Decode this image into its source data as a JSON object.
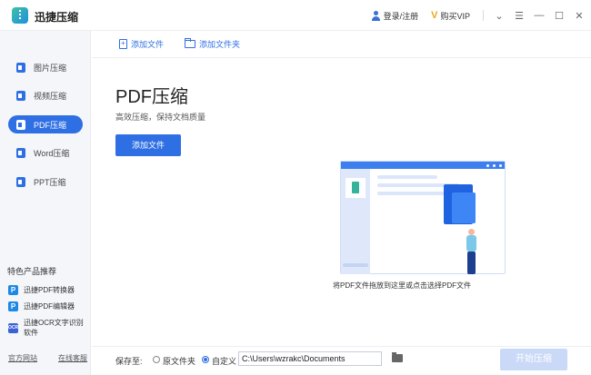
{
  "app": {
    "title": "迅捷压缩"
  },
  "titlebar": {
    "login": "登录/注册",
    "vip_badge": "V",
    "vip": "购买VIP",
    "controls": [
      "chevron-down-icon",
      "menu-icon",
      "minimize-icon",
      "maximize-icon",
      "close-icon"
    ]
  },
  "sidebar": {
    "items": [
      {
        "label": "图片压缩",
        "icon": "image-icon"
      },
      {
        "label": "视频压缩",
        "icon": "video-icon"
      },
      {
        "label": "PDF压缩",
        "icon": "pdf-icon",
        "active": true
      },
      {
        "label": "Word压缩",
        "icon": "word-icon"
      },
      {
        "label": "PPT压缩",
        "icon": "ppt-icon"
      }
    ],
    "featured_title": "特色产品推荐",
    "featured": [
      {
        "label": "迅捷PDF转换器",
        "badge": "P"
      },
      {
        "label": "迅捷PDF编辑器",
        "badge": "P"
      },
      {
        "label": "迅捷OCR文字识别软件",
        "badge": "OCR"
      }
    ],
    "footer": {
      "website": "官方网站",
      "support": "在线客服"
    }
  },
  "toolbar": {
    "add_file": "添加文件",
    "add_folder": "添加文件夹"
  },
  "main": {
    "title": "PDF压缩",
    "subtitle": "高效压缩，保持文档质量",
    "add_button": "添加文件",
    "drop_hint": "将PDF文件拖放到这里或点击选择PDF文件"
  },
  "bottom": {
    "save_to": "保存至:",
    "option_original": "原文件夹",
    "option_custom": "自定义",
    "selected_option": "自定义",
    "path": "C:\\Users\\wzrakc\\Documents",
    "start_button": "开始压缩"
  },
  "colors": {
    "accent": "#2f6fe4",
    "disabled": "#c9d9f7"
  }
}
